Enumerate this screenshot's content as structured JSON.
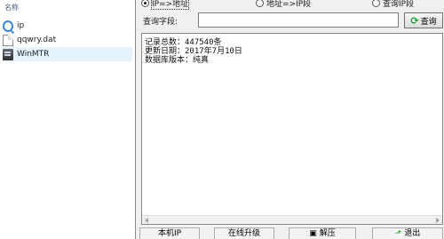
{
  "explorer": {
    "column_header": "名称",
    "files": [
      {
        "name": "ip",
        "icon": "search-icon"
      },
      {
        "name": "qqwry.dat",
        "icon": "document-icon"
      },
      {
        "name": "WinMTR",
        "icon": "app-icon"
      }
    ]
  },
  "app": {
    "radios": [
      {
        "label": "IP=>地址",
        "checked": true
      },
      {
        "label": "地址=>IP段",
        "checked": false
      },
      {
        "label": "查询IP段",
        "checked": false
      }
    ],
    "query": {
      "label": "查询字段:",
      "value": "",
      "button_label": "查询"
    },
    "result_lines": [
      "记录总数：447540条",
      "更新日期：2017年7月10日",
      "数据库版本：纯真"
    ],
    "bottom_buttons": [
      {
        "label": "本机IP"
      },
      {
        "label": "在线升级"
      },
      {
        "label": "解压"
      },
      {
        "label": "退出"
      }
    ]
  }
}
